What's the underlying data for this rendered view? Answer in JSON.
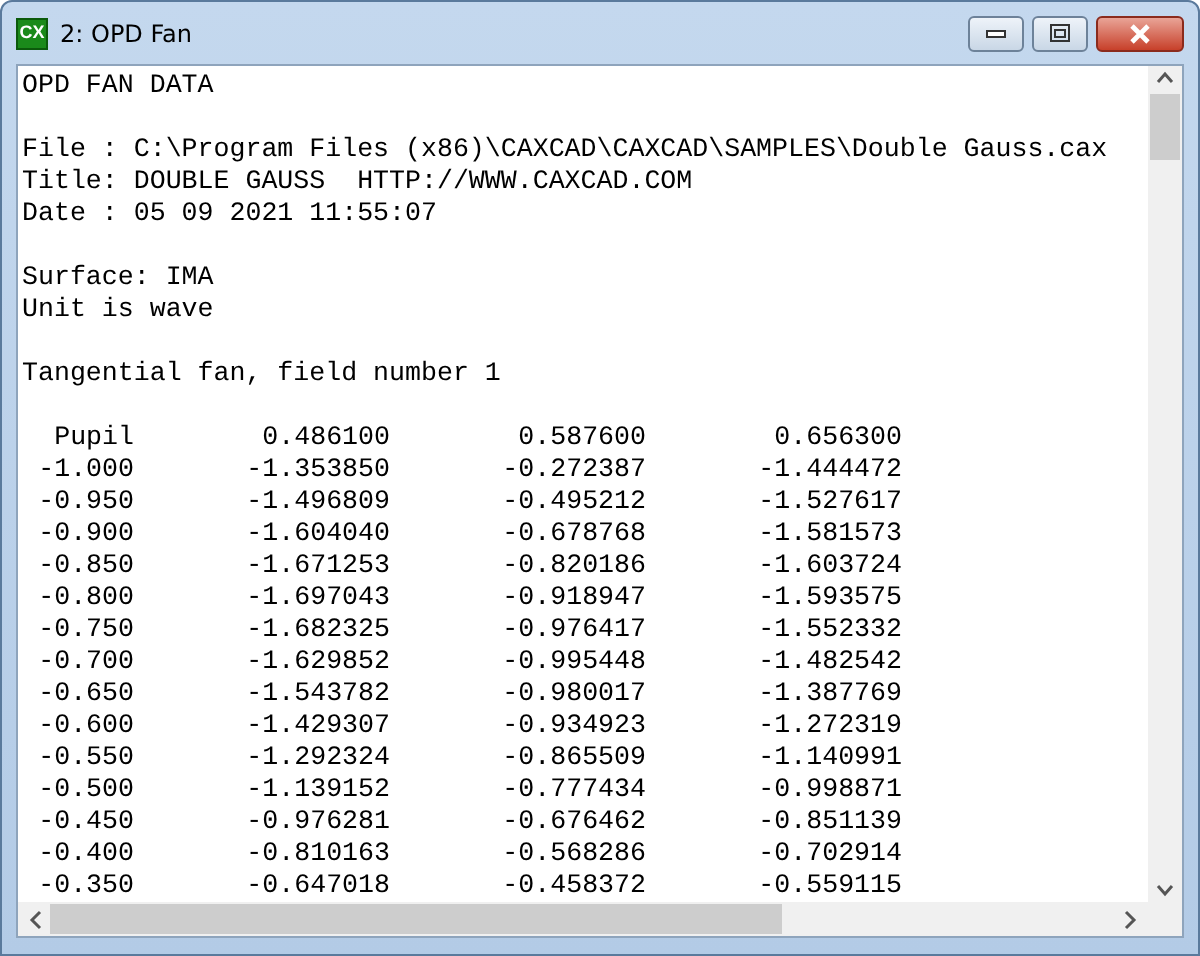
{
  "window": {
    "title": "2: OPD Fan",
    "icon_text": "CX"
  },
  "text_blocks": [
    [
      "OPD FAN DATA"
    ],
    [
      "File : C:\\Program Files (x86)\\CAXCAD\\CAXCAD\\SAMPLES\\Double Gauss.cax",
      "Title: DOUBLE GAUSS  HTTP://WWW.CAXCAD.COM",
      "Date : 05 09 2021 11:55:07"
    ],
    [
      "Surface: IMA",
      "Unit is wave"
    ],
    [
      "Tangential fan, field number 1"
    ]
  ],
  "table": {
    "columns": [
      "Pupil",
      "0.486100",
      "0.587600",
      "0.656300"
    ],
    "rows": [
      [
        "-1.000",
        "-1.353850",
        "-0.272387",
        "-1.444472"
      ],
      [
        "-0.950",
        "-1.496809",
        "-0.495212",
        "-1.527617"
      ],
      [
        "-0.900",
        "-1.604040",
        "-0.678768",
        "-1.581573"
      ],
      [
        "-0.850",
        "-1.671253",
        "-0.820186",
        "-1.603724"
      ],
      [
        "-0.800",
        "-1.697043",
        "-0.918947",
        "-1.593575"
      ],
      [
        "-0.750",
        "-1.682325",
        "-0.976417",
        "-1.552332"
      ],
      [
        "-0.700",
        "-1.629852",
        "-0.995448",
        "-1.482542"
      ],
      [
        "-0.650",
        "-1.543782",
        "-0.980017",
        "-1.387769"
      ],
      [
        "-0.600",
        "-1.429307",
        "-0.934923",
        "-1.272319"
      ],
      [
        "-0.550",
        "-1.292324",
        "-0.865509",
        "-1.140991"
      ],
      [
        "-0.500",
        "-1.139152",
        "-0.777434",
        "-0.998871"
      ],
      [
        "-0.450",
        "-0.976281",
        "-0.676462",
        "-0.851139"
      ],
      [
        "-0.400",
        "-0.810163",
        "-0.568286",
        "-0.702914"
      ],
      [
        "-0.350",
        "-0.647018",
        "-0.458372",
        "-0.559115"
      ]
    ]
  }
}
